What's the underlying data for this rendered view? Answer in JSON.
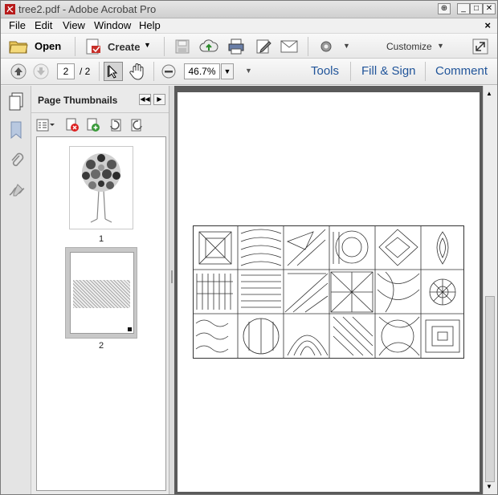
{
  "window": {
    "title": "tree2.pdf - Adobe Acrobat Pro"
  },
  "window_buttons": {
    "restore": "⊕",
    "minimize": "_",
    "maximize": "□",
    "close": "✕"
  },
  "menu": {
    "items": [
      "File",
      "Edit",
      "View",
      "Window",
      "Help"
    ],
    "close_glyph": "×"
  },
  "toolbar": {
    "open_label": "Open",
    "create_label": "Create",
    "customize_label": "Customize"
  },
  "navigation": {
    "current_page": "2",
    "total_pages": "/ 2",
    "zoom": "46.7%"
  },
  "tabs": {
    "tools": "Tools",
    "fill_sign": "Fill & Sign",
    "comment": "Comment"
  },
  "panel": {
    "title": "Page Thumbnails",
    "thumbnails": [
      {
        "label": "1"
      },
      {
        "label": "2"
      }
    ],
    "selected": 2
  },
  "colors": {
    "accent_link": "#21559a",
    "selected_thumb": "#c8c8c8",
    "doc_background": "#5a5a5a"
  }
}
